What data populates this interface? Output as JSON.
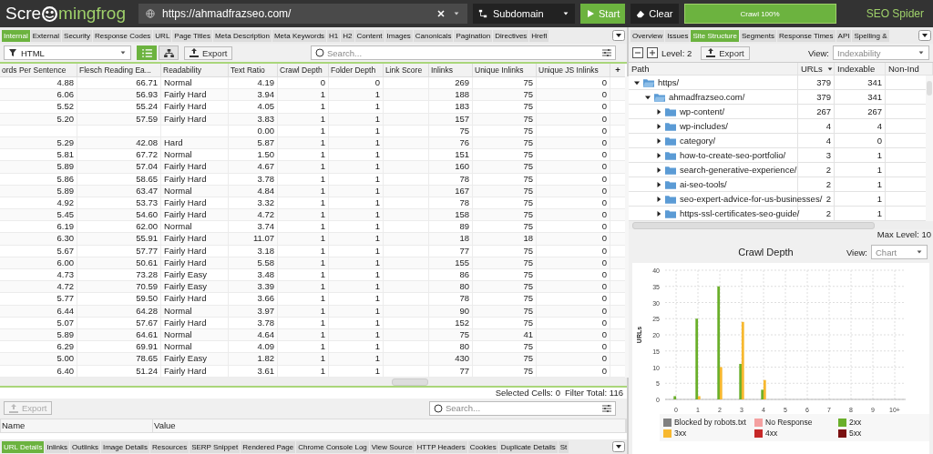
{
  "top_bar": {
    "logo_parts": [
      "Scre",
      "mingfrog"
    ],
    "url": "https://ahmadfrazseo.com/",
    "mode": "Subdomain",
    "start": "Start",
    "clear": "Clear",
    "progress": {
      "label": "Crawl 100%",
      "level": 1
    },
    "product": "SEO Spider"
  },
  "tabs": [
    {
      "label": "Internal",
      "selected": true
    },
    {
      "label": "External",
      "selected": false
    },
    {
      "label": "Security",
      "selected": false
    },
    {
      "label": "Response Codes",
      "selected": false
    },
    {
      "label": "URL",
      "selected": false
    },
    {
      "label": "Page Titles",
      "selected": false
    },
    {
      "label": "Meta Description",
      "selected": false
    },
    {
      "label": "Meta Keywords",
      "selected": false
    },
    {
      "label": "H1",
      "selected": false
    },
    {
      "label": "H2",
      "selected": false
    },
    {
      "label": "Content",
      "selected": false
    },
    {
      "label": "Images",
      "selected": false
    },
    {
      "label": "Canonicals",
      "selected": false
    },
    {
      "label": "Pagination",
      "selected": false
    },
    {
      "label": "Directives",
      "selected": false
    },
    {
      "label": "Hrefl",
      "selected": false
    }
  ],
  "toolbar": {
    "filter": "HTML",
    "views": [
      {
        "kind": "list",
        "selected": true
      },
      {
        "kind": "tree",
        "selected": false
      }
    ],
    "export": "Export",
    "search_placeholder": "Search..."
  },
  "table": {
    "columns": [
      {
        "label": "ords Per Sentence",
        "kind": "number"
      },
      {
        "label": "Flesch Reading Ea...",
        "kind": "number"
      },
      {
        "label": "Readability",
        "kind": "text"
      },
      {
        "label": "Text Ratio",
        "kind": "number"
      },
      {
        "label": "Crawl Depth",
        "kind": "number"
      },
      {
        "label": "Folder Depth",
        "kind": "number"
      },
      {
        "label": "Link Score",
        "kind": "number"
      },
      {
        "label": "Inlinks",
        "kind": "number"
      },
      {
        "label": "Unique Inlinks",
        "kind": "number"
      },
      {
        "label": "Unique JS Inlinks",
        "kind": "number"
      }
    ],
    "add_column": "+",
    "rows": [
      [
        "4.88",
        "66.71",
        "Normal",
        "4.19",
        "0",
        "0",
        null,
        "269",
        "75",
        "0"
      ],
      [
        "6.06",
        "56.93",
        "Fairly Hard",
        "3.94",
        "1",
        "1",
        null,
        "188",
        "75",
        "0"
      ],
      [
        "5.52",
        "55.24",
        "Fairly Hard",
        "4.05",
        "1",
        "1",
        null,
        "183",
        "75",
        "0"
      ],
      [
        "5.20",
        "57.59",
        "Fairly Hard",
        "3.83",
        "1",
        "1",
        null,
        "157",
        "75",
        "0"
      ],
      [
        null,
        null,
        null,
        "0.00",
        "1",
        "1",
        null,
        "75",
        "75",
        "0"
      ],
      [
        "5.29",
        "42.08",
        "Hard",
        "5.87",
        "1",
        "1",
        null,
        "76",
        "75",
        "0"
      ],
      [
        "5.81",
        "67.72",
        "Normal",
        "1.50",
        "1",
        "1",
        null,
        "151",
        "75",
        "0"
      ],
      [
        "5.89",
        "57.04",
        "Fairly Hard",
        "4.67",
        "1",
        "1",
        null,
        "160",
        "75",
        "0"
      ],
      [
        "5.86",
        "58.65",
        "Fairly Hard",
        "3.78",
        "1",
        "1",
        null,
        "78",
        "75",
        "0"
      ],
      [
        "5.89",
        "63.47",
        "Normal",
        "4.84",
        "1",
        "1",
        null,
        "167",
        "75",
        "0"
      ],
      [
        "4.92",
        "53.73",
        "Fairly Hard",
        "3.32",
        "1",
        "1",
        null,
        "78",
        "75",
        "0"
      ],
      [
        "5.45",
        "54.60",
        "Fairly Hard",
        "4.72",
        "1",
        "1",
        null,
        "158",
        "75",
        "0"
      ],
      [
        "6.19",
        "62.00",
        "Normal",
        "3.74",
        "1",
        "1",
        null,
        "89",
        "75",
        "0"
      ],
      [
        "6.30",
        "55.91",
        "Fairly Hard",
        "11.07",
        "1",
        "1",
        null,
        "18",
        "18",
        "0"
      ],
      [
        "5.67",
        "57.77",
        "Fairly Hard",
        "3.18",
        "1",
        "1",
        null,
        "77",
        "75",
        "0"
      ],
      [
        "6.00",
        "50.61",
        "Fairly Hard",
        "5.58",
        "1",
        "1",
        null,
        "155",
        "75",
        "0"
      ],
      [
        "4.73",
        "73.28",
        "Fairly Easy",
        "3.48",
        "1",
        "1",
        null,
        "86",
        "75",
        "0"
      ],
      [
        "4.72",
        "70.59",
        "Fairly Easy",
        "3.39",
        "1",
        "1",
        null,
        "80",
        "75",
        "0"
      ],
      [
        "5.77",
        "59.50",
        "Fairly Hard",
        "3.66",
        "1",
        "1",
        null,
        "78",
        "75",
        "0"
      ],
      [
        "6.44",
        "64.28",
        "Normal",
        "3.97",
        "1",
        "1",
        null,
        "90",
        "75",
        "0"
      ],
      [
        "5.07",
        "57.67",
        "Fairly Hard",
        "3.78",
        "1",
        "1",
        null,
        "152",
        "75",
        "0"
      ],
      [
        "5.89",
        "64.61",
        "Normal",
        "4.64",
        "1",
        "1",
        null,
        "75",
        "41",
        "0"
      ],
      [
        "6.29",
        "69.91",
        "Normal",
        "4.09",
        "1",
        "1",
        null,
        "80",
        "75",
        "0"
      ],
      [
        "5.00",
        "78.65",
        "Fairly Easy",
        "1.82",
        "1",
        "1",
        null,
        "430",
        "75",
        "0"
      ],
      [
        "6.40",
        "51.24",
        "Fairly Hard",
        "3.61",
        "1",
        "1",
        null,
        "77",
        "75",
        "0"
      ]
    ]
  },
  "status": {
    "selected_cells": "Selected Cells:  0",
    "filter_total": "Filter Total:  116"
  },
  "details": {
    "export": "Export",
    "export_disabled": true,
    "search_placeholder": "Search...",
    "columns": [
      "Name",
      "Value"
    ]
  },
  "bottom_tabs": [
    {
      "label": "URL Details",
      "selected": true
    },
    {
      "label": "Inlinks",
      "selected": false
    },
    {
      "label": "Outlinks",
      "selected": false
    },
    {
      "label": "Image Details",
      "selected": false
    },
    {
      "label": "Resources",
      "selected": false
    },
    {
      "label": "SERP Snippet",
      "selected": false
    },
    {
      "label": "Rendered Page",
      "selected": false
    },
    {
      "label": "Chrome Console Log",
      "selected": false
    },
    {
      "label": "View Source",
      "selected": false
    },
    {
      "label": "HTTP Headers",
      "selected": false
    },
    {
      "label": "Cookies",
      "selected": false
    },
    {
      "label": "Duplicate Details",
      "selected": false
    },
    {
      "label": "St",
      "selected": false
    }
  ],
  "right_tabs": [
    {
      "label": "Overview",
      "selected": false
    },
    {
      "label": "Issues",
      "selected": false
    },
    {
      "label": "Site Structure",
      "selected": true
    },
    {
      "label": "Segments",
      "selected": false
    },
    {
      "label": "Response Times",
      "selected": false
    },
    {
      "label": "API",
      "selected": false
    },
    {
      "label": "Spelling & ",
      "selected": false
    }
  ],
  "structure": {
    "level": "Level: 2",
    "export": "Export",
    "view_label": "View:",
    "view": "Indexability",
    "columns": [
      "Path",
      "URLs",
      "Indexable",
      "Non-Ind"
    ],
    "tree": [
      {
        "name": "https/",
        "urls": "379",
        "indexable": "341",
        "expanded": true,
        "children": [
          {
            "name": "ahmadfrazseo.com/",
            "urls": "379",
            "indexable": "341",
            "expanded": true,
            "children": [
              {
                "name": "wp-content/",
                "urls": "267",
                "indexable": "267",
                "expanded": false
              },
              {
                "name": "wp-includes/",
                "urls": "4",
                "indexable": "4",
                "expanded": false
              },
              {
                "name": "category/",
                "urls": "4",
                "indexable": "0",
                "expanded": false
              },
              {
                "name": "how-to-create-seo-portfolio/",
                "urls": "3",
                "indexable": "1",
                "expanded": false
              },
              {
                "name": "search-generative-experience/",
                "urls": "2",
                "indexable": "1",
                "expanded": false
              },
              {
                "name": "ai-seo-tools/",
                "urls": "2",
                "indexable": "1",
                "expanded": false
              },
              {
                "name": "seo-expert-advice-for-us-businesses/",
                "urls": "2",
                "indexable": "1",
                "expanded": false
              },
              {
                "name": "https-ssl-certificates-seo-guide/",
                "urls": "2",
                "indexable": "1",
                "expanded": false
              }
            ]
          }
        ]
      }
    ],
    "max_level": "Max Level: 10"
  },
  "crawl_depth": {
    "view_label": "View:",
    "view": "Chart",
    "chart_data": {
      "type": "bar",
      "title": "Crawl Depth",
      "grid": true,
      "legend": true,
      "ylabel": "URLs",
      "categories": [
        "0",
        "1",
        "2",
        "3",
        "4",
        "5",
        "6",
        "7",
        "8",
        "9",
        "10+"
      ],
      "ylim": [
        0,
        40
      ],
      "yticks": [
        0,
        5,
        10,
        15,
        20,
        25,
        30,
        35,
        40
      ],
      "series": [
        {
          "name": "Blocked by robots.txt",
          "color": "#808080",
          "values": [
            0,
            0,
            0,
            0,
            0,
            0,
            0,
            0,
            0,
            0,
            0
          ]
        },
        {
          "name": "No Response",
          "color": "#f4a0a0",
          "values": [
            0,
            0,
            0,
            0,
            0,
            0,
            0,
            0,
            0,
            0,
            0
          ]
        },
        {
          "name": "2xx",
          "color": "#6aaf2a",
          "values": [
            1,
            25,
            35,
            11,
            3,
            0,
            0,
            0,
            0,
            0,
            0
          ]
        },
        {
          "name": "3xx",
          "color": "#f7b82f",
          "values": [
            0,
            1,
            10,
            24,
            6,
            0,
            0,
            0,
            0,
            0,
            0
          ]
        },
        {
          "name": "4xx",
          "color": "#c62828",
          "values": [
            0,
            0,
            0,
            0,
            0,
            0,
            0,
            0,
            0,
            0,
            0
          ]
        },
        {
          "name": "5xx",
          "color": "#7a1010",
          "values": [
            0,
            0,
            0,
            0,
            0,
            0,
            0,
            0,
            0,
            0,
            0
          ]
        }
      ]
    }
  }
}
